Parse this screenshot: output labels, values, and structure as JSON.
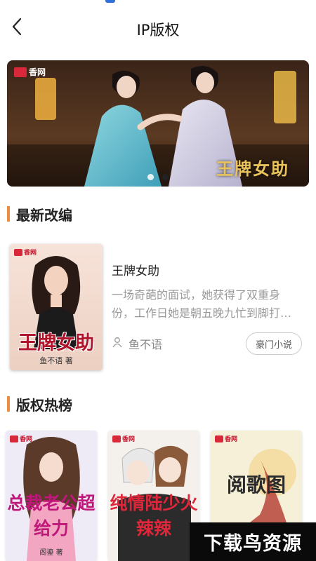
{
  "header": {
    "title": "IP版权",
    "back_icon": "chevron-left-icon"
  },
  "banner": {
    "logo": "香网",
    "art_title": "王牌女助",
    "slide_count": 2,
    "active_slide": 2
  },
  "latest": {
    "section_title": "最新改编",
    "book": {
      "cover_logo": "香网",
      "cover_title": "王牌女助",
      "cover_author": "鱼不语 著",
      "title": "王牌女助",
      "description": "一场奇葩的面试，她获得了双重身份，工作日她是朝五晚九忙到脚打…",
      "author": "鱼不语",
      "tag": "豪门小说"
    }
  },
  "hot": {
    "section_title": "版权热榜",
    "items": [
      {
        "cover_logo": "香网",
        "cover_title": "总裁老公超给力",
        "cover_author": "阁鎏 著"
      },
      {
        "cover_logo": "香网",
        "cover_title": "纯情陆少火辣辣",
        "cover_author": ""
      },
      {
        "cover_logo": "香网",
        "cover_title": "阅歌图",
        "cover_author": ""
      }
    ]
  },
  "watermark": "下载鸟资源",
  "colors": {
    "accent": "#f08a3c",
    "brand_red": "#d9283a",
    "text_muted": "#999999"
  }
}
